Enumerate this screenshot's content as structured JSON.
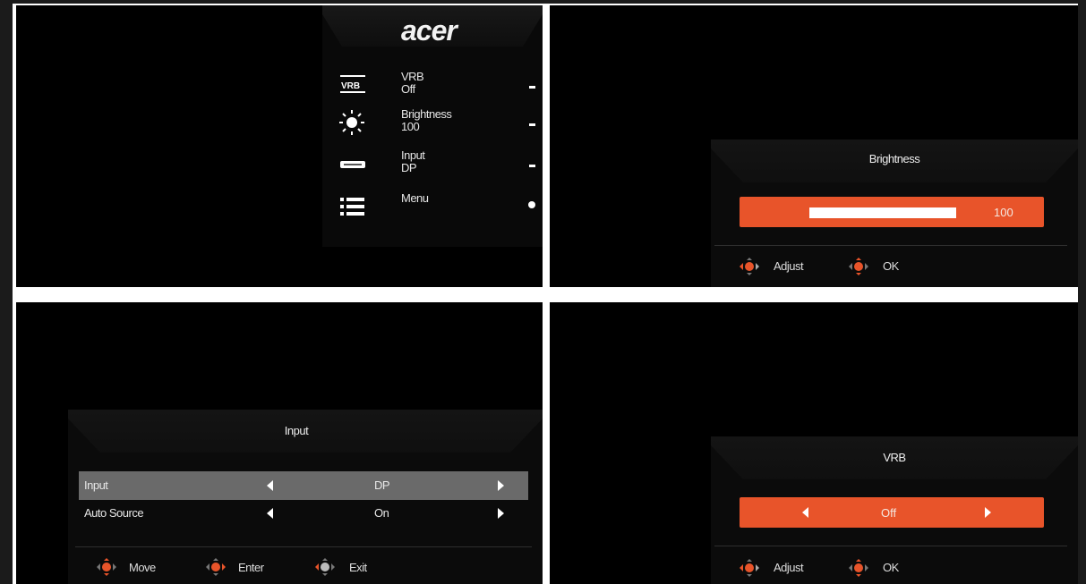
{
  "quick_menu": {
    "logo": "acer",
    "items": [
      {
        "label": "VRB",
        "value": "Off",
        "icon": "vrb-icon"
      },
      {
        "label": "Brightness",
        "value": "100",
        "icon": "sun-icon"
      },
      {
        "label": "Input",
        "value": "DP",
        "icon": "input-connector-icon"
      },
      {
        "label": "Menu",
        "value": "",
        "icon": "list-menu-icon"
      }
    ]
  },
  "brightness_dialog": {
    "title": "Brightness",
    "value": "100",
    "level_fraction": 1.0,
    "hints": [
      {
        "label": "Adjust",
        "icon": "dpad-lr-icon"
      },
      {
        "label": "OK",
        "icon": "dpad-center-icon"
      }
    ]
  },
  "input_dialog": {
    "title": "Input",
    "rows": [
      {
        "label": "Input",
        "value": "DP",
        "selected": true
      },
      {
        "label": "Auto Source",
        "value": "On",
        "selected": false
      }
    ],
    "hints": [
      {
        "label": "Move",
        "icon": "dpad-ud-icon"
      },
      {
        "label": "Enter",
        "icon": "dpad-center-icon"
      },
      {
        "label": "Exit",
        "icon": "dpad-lr-icon"
      }
    ]
  },
  "vrb_dialog": {
    "title": "VRB",
    "value": "Off",
    "hints": [
      {
        "label": "Adjust",
        "icon": "dpad-lr-icon"
      },
      {
        "label": "OK",
        "icon": "dpad-center-icon"
      }
    ]
  },
  "colors": {
    "accent": "#e8542a",
    "selected_row": "#6a6a6a",
    "panel_bg": "#000000"
  }
}
